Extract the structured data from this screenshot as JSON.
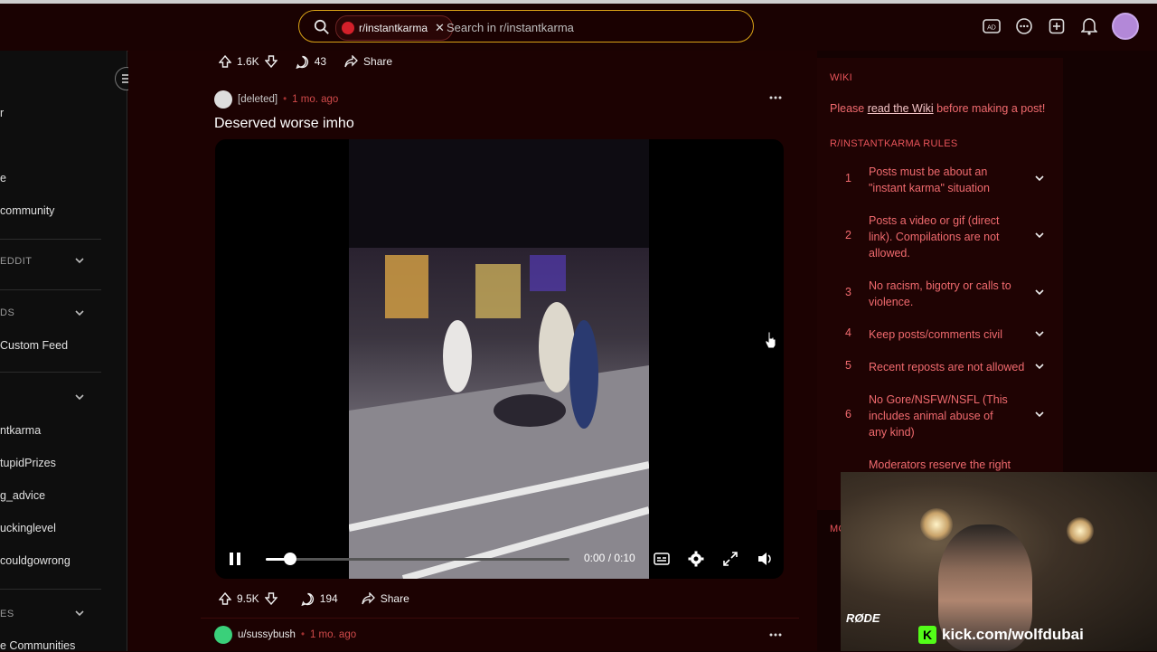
{
  "header": {
    "search": {
      "chip_label": "r/instantkarma",
      "placeholder": "Search in r/instantkarma"
    },
    "icons": [
      "advertise-icon",
      "chat-icon",
      "create-post-icon",
      "notifications-icon",
      "avatar"
    ]
  },
  "sidebar": {
    "items": [
      {
        "label": "r",
        "type": "item"
      },
      {
        "label": "e",
        "type": "item"
      },
      {
        "label": "community",
        "type": "item"
      },
      {
        "label": "EDDIT",
        "type": "heading"
      },
      {
        "label": "DS",
        "type": "heading"
      },
      {
        "label": "Custom Feed",
        "type": "item"
      },
      {
        "label": "",
        "type": "heading"
      },
      {
        "label": "ntkarma",
        "type": "item"
      },
      {
        "label": "tupidPrizes",
        "type": "item"
      },
      {
        "label": "g_advice",
        "type": "item"
      },
      {
        "label": "uckinglevel",
        "type": "item"
      },
      {
        "label": "couldgowrong",
        "type": "item"
      },
      {
        "label": "ES",
        "type": "heading"
      },
      {
        "label": "e Communities",
        "type": "item"
      }
    ]
  },
  "feed": {
    "prev_post": {
      "upvotes": "1.6K",
      "comments": "43",
      "share": "Share"
    },
    "post": {
      "user": "[deleted]",
      "time": "1 mo. ago",
      "title": "Deserved worse imho",
      "video": {
        "time_display": "0:00 / 0:10",
        "progress": 0.08
      },
      "upvotes": "9.5K",
      "comments": "194",
      "share": "Share"
    },
    "next_post": {
      "user": "u/sussybush",
      "time": "1 mo. ago"
    }
  },
  "right_sidebar": {
    "wiki_heading": "WIKI",
    "wiki_prefix": "Please ",
    "wiki_link": "read the Wiki",
    "wiki_suffix": " before making a post!",
    "rules_heading": "R/INSTANTKARMA RULES",
    "rules": [
      {
        "num": "1",
        "text": "Posts must be about an \"instant karma\" situation"
      },
      {
        "num": "2",
        "text": "Posts a video or gif (direct link). Compilations are not allowed."
      },
      {
        "num": "3",
        "text": "No racism, bigotry or calls to violence."
      },
      {
        "num": "4",
        "text": "Keep posts/comments civil"
      },
      {
        "num": "5",
        "text": "Recent reposts are not allowed"
      },
      {
        "num": "6",
        "text": "No Gore/NSFW/NSFL (This includes animal abuse of any kind)"
      },
      {
        "num": "7",
        "text": "Moderators reserve the right"
      }
    ],
    "mods_heading_partial": "MO"
  },
  "overlay": {
    "kick_url": "kick.com/wolfdubai",
    "mic_brand": "RØDE"
  },
  "colors": {
    "accent": "#f06a6e",
    "search_border": "#d9a216",
    "kick_green": "#53fc18"
  }
}
